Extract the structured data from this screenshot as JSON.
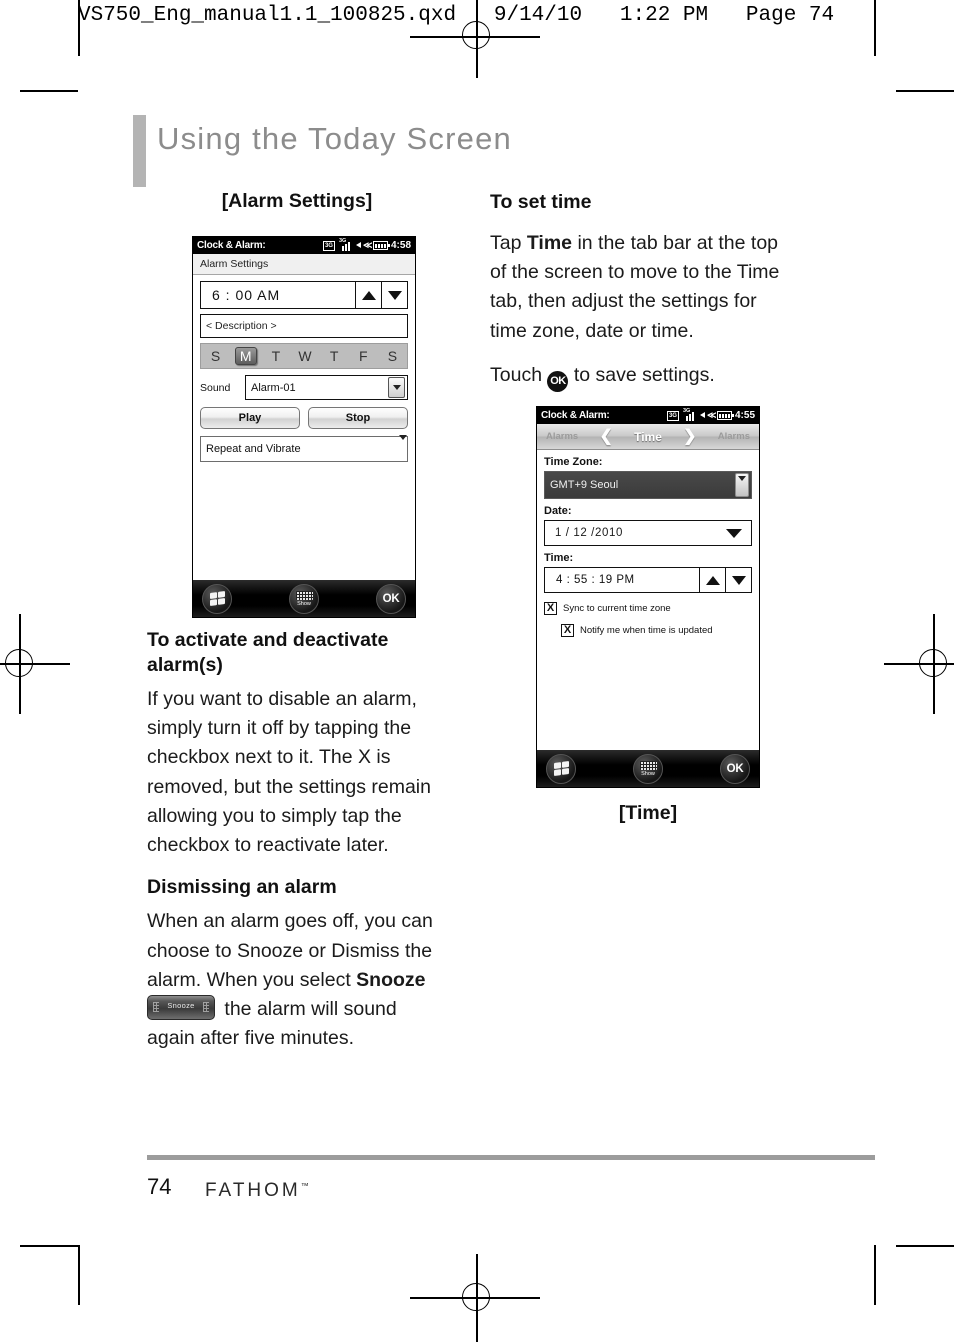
{
  "print_header": "VS750_Eng_manual1.1_100825.qxd   9/14/10   1:22 PM   Page 74",
  "page_title": "Using the Today Screen",
  "left_column": {
    "caption": "[Alarm Settings]",
    "heading_activate": "To activate and deactivate alarm(s)",
    "body_activate": "If you want to disable an alarm, simply turn it off by tapping the checkbox next to it. The X is removed, but the settings remain allowing you to simply tap the checkbox to reactivate later.",
    "heading_dismiss": "Dismissing an alarm",
    "body_dismiss_1": "When an alarm goes off, you can choose to Snooze or Dismiss the alarm. When you select ",
    "body_dismiss_bold": "Snooze",
    "snooze_button_label": "Snooze",
    "body_dismiss_2": " the alarm will sound again after five minutes."
  },
  "right_column": {
    "heading": "To set time",
    "body_1a": "Tap ",
    "body_1b": "Time",
    "body_1c": " in the tab bar at the top of the screen to move to the Time tab, then adjust the settings for time zone, date or time.",
    "body_2a": "Touch ",
    "ok_glyph": "OK",
    "body_2b": " to save settings.",
    "caption": "[Time]"
  },
  "phone_alarm": {
    "title": "Clock & Alarm:",
    "status": {
      "data_icon": "3G",
      "signal_icon": "signal-bars",
      "speaker_icon": "speaker",
      "battery_icon": "battery",
      "clock": "4:58"
    },
    "tab_label": "Alarm Settings",
    "time_value": "6 : 00  AM",
    "spin_up": "arrow-up",
    "spin_down": "arrow-down",
    "description_placeholder": "< Description >",
    "days": [
      "S",
      "M",
      "T",
      "W",
      "T",
      "F",
      "S"
    ],
    "selected_day_index": 1,
    "sound_label": "Sound",
    "sound_value": "Alarm-01",
    "play_label": "Play",
    "stop_label": "Stop",
    "repeat_value": "Repeat and Vibrate",
    "bottom_bar": {
      "start_label": "windows-start",
      "keyboard_label": "Show",
      "ok_label": "OK"
    }
  },
  "phone_time": {
    "title": "Clock & Alarm:",
    "status": {
      "data_icon": "3G",
      "signal_icon": "signal-bars",
      "speaker_icon": "speaker",
      "battery_icon": "battery",
      "clock": "4:55"
    },
    "tabs": {
      "left": "Alarms",
      "current": "Time",
      "right": "Alarms",
      "prev_icon": "chevron-left",
      "next_icon": "chevron-right"
    },
    "timezone_label": "Time Zone:",
    "timezone_value": "GMT+9 Seoul",
    "date_label": "Date:",
    "date_value": "1  /  12  /2010",
    "time_label": "Time:",
    "time_value": "4  :  55  :  19     PM",
    "checkbox_1": {
      "checked": "X",
      "label": "Sync to current time zone"
    },
    "checkbox_2": {
      "checked": "X",
      "label": "Notify me when time is updated"
    },
    "bottom_bar": {
      "start_label": "windows-start",
      "keyboard_label": "Show",
      "ok_label": "OK"
    }
  },
  "footer": {
    "page_number": "74",
    "brand": "FATHOM",
    "brand_tm": "™"
  },
  "colors": {
    "title_gray": "#8c8c8c",
    "accent_bar": "#b4b4b4",
    "rule_gray": "#9c9c9c"
  }
}
